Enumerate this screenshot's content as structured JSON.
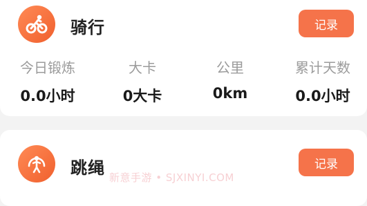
{
  "activities": [
    {
      "title": "骑行",
      "icon": "bicycle-icon",
      "record_label": "记录",
      "stats": [
        {
          "label": "今日锻炼",
          "value": "0.0小时"
        },
        {
          "label": "大卡",
          "value": "0大卡"
        },
        {
          "label": "公里",
          "value": "0km"
        },
        {
          "label": "累计天数",
          "value": "0.0小时"
        }
      ]
    },
    {
      "title": "跳绳",
      "icon": "jump-rope-icon",
      "record_label": "记录"
    }
  ],
  "watermark": "新意手游 • SJXINYI.COM",
  "colors": {
    "accent": "#f5734a",
    "icon_gradient_start": "#ff8a55",
    "icon_gradient_end": "#f0602e"
  }
}
